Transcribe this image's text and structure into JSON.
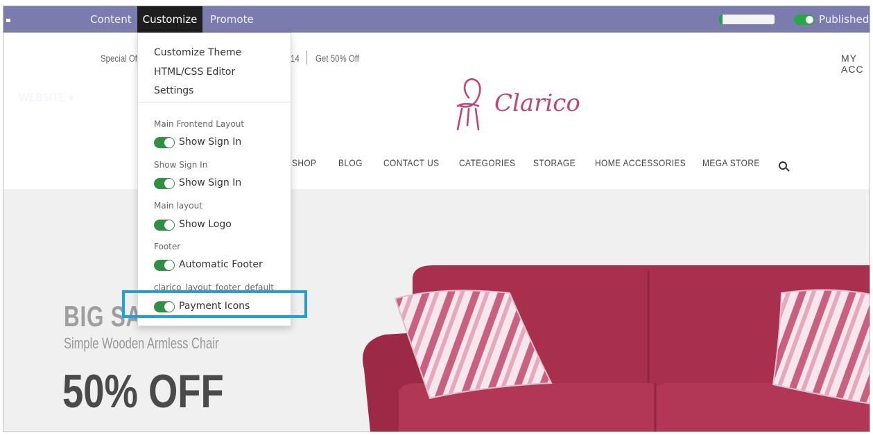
{
  "topbar": {
    "website_label": "WEBSITE ▾",
    "content_label": "Content",
    "customize_label": "Customize",
    "promote_label": "Promote",
    "published_label": "Published",
    "progress_fraction": 0.06,
    "accent_color": "#7c7bad"
  },
  "header": {
    "promo_left": "Special Of",
    "promo_mid": "14",
    "promo_right": "Get 50% Off",
    "my_account": "MY ACC",
    "logo_text": "Clarico",
    "brand_color": "#c0437a"
  },
  "nav": {
    "items": [
      "SHOP",
      "BLOG",
      "CONTACT US",
      "CATEGORIES",
      "STORAGE",
      "HOME ACCESSORIES",
      "MEGA STORE"
    ]
  },
  "hero": {
    "big_sale": "BIG SALE",
    "subtitle": "Simple Wooden Armless Chair",
    "offer": "50% OFF"
  },
  "customize_menu": {
    "items": [
      "Customize Theme",
      "HTML/CSS Editor",
      "Settings"
    ],
    "groups": [
      {
        "header": "Main Frontend Layout",
        "toggle": "Show Sign In",
        "on": true
      },
      {
        "header": "Show Sign In",
        "toggle": "Show Sign In",
        "on": true
      },
      {
        "header": "Main layout",
        "toggle": "Show Logo",
        "on": true
      },
      {
        "header": "Footer",
        "toggle": "Automatic Footer",
        "on": true
      },
      {
        "header": "clarico_layout_footer_default",
        "toggle": "Payment Icons",
        "on": true
      }
    ],
    "toggle_color": "#2f8f43"
  }
}
